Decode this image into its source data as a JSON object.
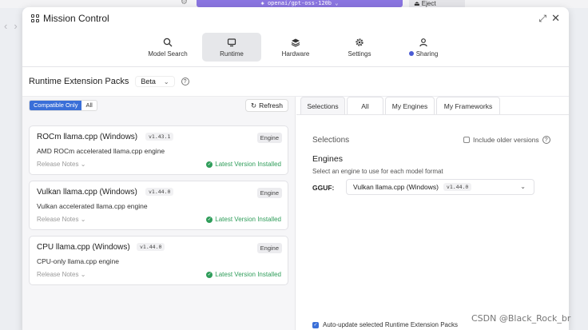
{
  "topbar": {
    "model_label": "openai/gpt-oss-120b",
    "eject_label": "Eject"
  },
  "modal": {
    "title": "Mission Control",
    "tabs": [
      {
        "label": "Model Search"
      },
      {
        "label": "Runtime"
      },
      {
        "label": "Hardware"
      },
      {
        "label": "Settings"
      },
      {
        "label": "Sharing"
      }
    ],
    "active_tab": "Runtime"
  },
  "header": {
    "title": "Runtime Extension Packs",
    "channel": "Beta"
  },
  "filter": {
    "options": [
      "Compatible Only",
      "All"
    ],
    "selected": "Compatible Only"
  },
  "refresh_label": "Refresh",
  "packs": [
    {
      "name": "ROCm llama.cpp (Windows)",
      "version": "v1.43.1",
      "badge": "Engine",
      "description": "AMD ROCm accelerated llama.cpp engine",
      "notes_label": "Release Notes",
      "status": "Latest Version Installed"
    },
    {
      "name": "Vulkan llama.cpp (Windows)",
      "version": "v1.44.0",
      "badge": "Engine",
      "description": "Vulkan accelerated llama.cpp engine",
      "notes_label": "Release Notes",
      "status": "Latest Version Installed"
    },
    {
      "name": "CPU llama.cpp (Windows)",
      "version": "v1.44.0",
      "badge": "Engine",
      "description": "CPU-only llama.cpp engine",
      "notes_label": "Release Notes",
      "status": "Latest Version Installed"
    }
  ],
  "right": {
    "tabs": [
      "Selections",
      "All",
      "My Engines",
      "My Frameworks"
    ],
    "active_tab": "Selections",
    "section_title": "Selections",
    "include_older_label": "Include older versions",
    "engines_title": "Engines",
    "engines_subtitle": "Select an engine to use for each model format",
    "format_label": "GGUF:",
    "format_engine": "Vulkan llama.cpp (Windows)",
    "format_version": "v1.44.0",
    "auto_update_label": "Auto-update selected Runtime Extension Packs"
  },
  "watermark": "CSDN @Black_Rock_br",
  "colors": {
    "accent": "#3a6fd8",
    "success": "#2f9d5a",
    "model_bar": "#8a75e0"
  }
}
